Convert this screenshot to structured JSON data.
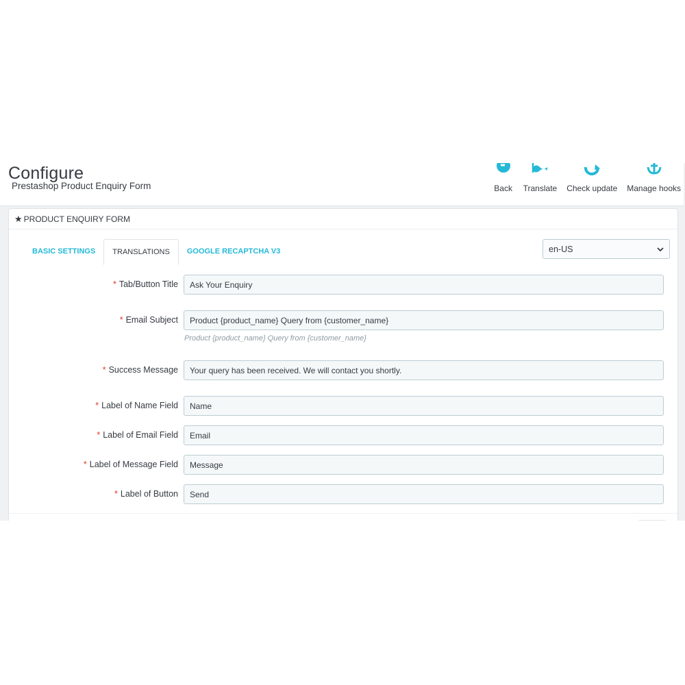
{
  "header": {
    "title": "Configure",
    "subtitle": "Prestashop Product Enquiry Form",
    "toolbar": [
      {
        "label": "Back",
        "icon": "back-icon"
      },
      {
        "label": "Translate",
        "icon": "flag-icon"
      },
      {
        "label": "Check update",
        "icon": "refresh-icon"
      },
      {
        "label": "Manage hooks",
        "icon": "anchor-icon"
      }
    ]
  },
  "panel": {
    "heading": "PRODUCT ENQUIRY FORM",
    "tabs": [
      {
        "label": "BASIC SETTINGS",
        "active": false
      },
      {
        "label": "TRANSLATIONS",
        "active": true
      },
      {
        "label": "GOOGLE RECAPTCHA V3",
        "active": false
      }
    ],
    "language": "en-US"
  },
  "form": {
    "tab_title": {
      "label": "Tab/Button Title",
      "value": "Ask Your Enquiry"
    },
    "email_subject": {
      "label": "Email Subject",
      "value": "Product {product_name} Query from {customer_name}",
      "help": "Product {product_name} Query from {customer_name}"
    },
    "success_message": {
      "label": "Success Message",
      "value": "Your query has been received. We will contact you shortly."
    },
    "name_label": {
      "label": "Label of Name Field",
      "value": "Name"
    },
    "email_label": {
      "label": "Label of Email Field",
      "value": "Email"
    },
    "message_label": {
      "label": "Label of Message Field",
      "value": "Message"
    },
    "button_label": {
      "label": "Label of Button",
      "value": "Send"
    }
  },
  "colors": {
    "accent": "#25b9d7",
    "required": "#e3382b",
    "text": "#363a41"
  }
}
